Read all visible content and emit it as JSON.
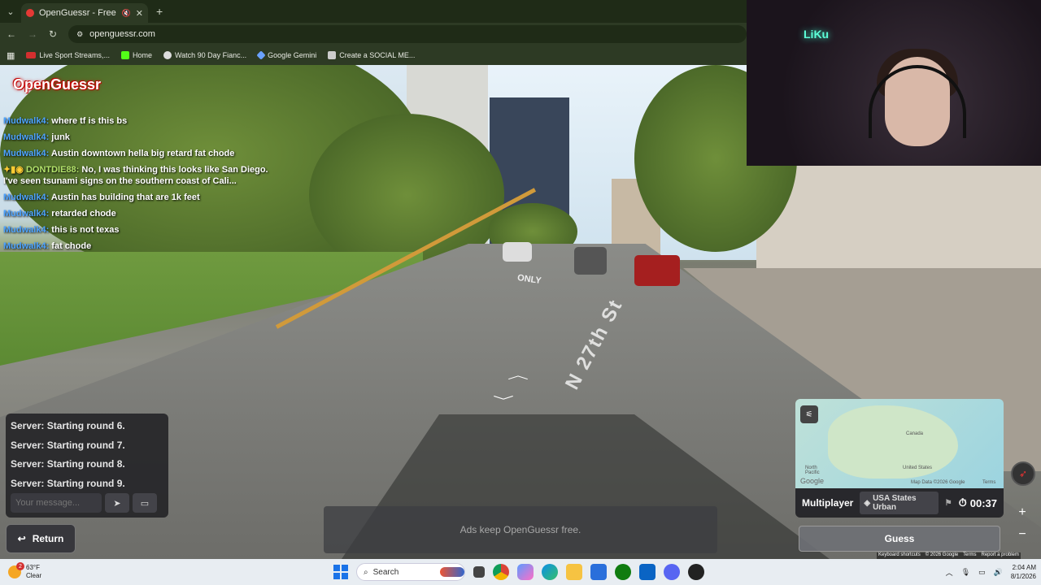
{
  "browser": {
    "tab_title": "OpenGuessr - Free GeoGue",
    "url": "openguessr.com",
    "bookmarks": [
      {
        "label": "Live Sport Streams,..."
      },
      {
        "label": "Home"
      },
      {
        "label": "Watch 90 Day Fianc..."
      },
      {
        "label": "Google Gemini"
      },
      {
        "label": "Create a SOCIAL ME..."
      }
    ]
  },
  "game": {
    "logo": "OpenGuessr",
    "street_label": "N 27th St",
    "road_marking": "ONLY"
  },
  "chat": [
    {
      "user": "Mudwalk4:",
      "text": "where tf is this bs"
    },
    {
      "user": "Mudwalk4:",
      "text": "junk"
    },
    {
      "user": "Mudwalk4:",
      "text": "Austin downtown hella big retard fat chode"
    },
    {
      "user": "DONTDIE88:",
      "text": "No, I was thinking this looks like San Diego. I've seen tsunami signs on the southern coast of Cali..."
    },
    {
      "user": "Mudwalk4:",
      "text": "Austin has building that are 1k feet"
    },
    {
      "user": "Mudwalk4:",
      "text": "retarded chode"
    },
    {
      "user": "Mudwalk4:",
      "text": "this is not texas"
    },
    {
      "user": "Mudwalk4:",
      "text": "fat chode"
    }
  ],
  "server_log": [
    "Server: Starting round 6.",
    "Server: Starting round 7.",
    "Server: Starting round 8.",
    "Server: Starting round 9."
  ],
  "message_input": {
    "placeholder": "Your message..."
  },
  "buttons": {
    "return": "Return",
    "guess": "Guess"
  },
  "ads_text": "Ads keep OpenGuessr free.",
  "map": {
    "labels": {
      "canada": "Canada",
      "usa": "United States",
      "north_pacific": "North Pacific",
      "attribution": "Map Data ©2026 Google",
      "terms": "Terms",
      "google": "Google"
    }
  },
  "gamebar": {
    "mode": "Multiplayer",
    "map_name": "USA States Urban",
    "timer": "00:37"
  },
  "google_footer": {
    "shortcuts": "Keyboard shortcuts",
    "copyright": "© 2026 Google",
    "terms": "Terms",
    "report": "Report a problem"
  },
  "webcam": {
    "neon_sign": "LiKu"
  },
  "taskbar": {
    "weather_temp": "63°F",
    "weather_desc": "Clear",
    "weather_badge": "2",
    "search_label": "Search",
    "time": "2:04 AM",
    "date": "8/1/2026"
  },
  "colors": {
    "accent_red": "#e53935",
    "chat_user": "#4da3ff",
    "chat_user_alt": "#b3e36b"
  }
}
